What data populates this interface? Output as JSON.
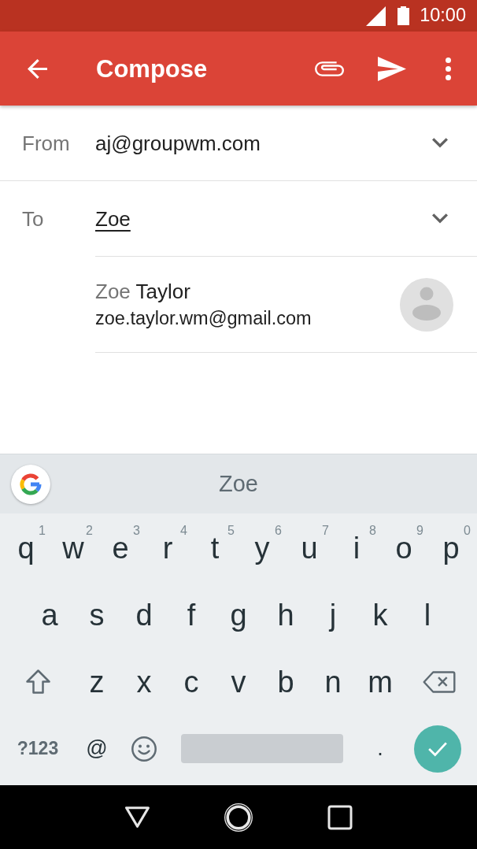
{
  "status_bar": {
    "time": "10:00"
  },
  "app_bar": {
    "title": "Compose"
  },
  "from": {
    "label": "From",
    "value": "aj@groupwm.com"
  },
  "to": {
    "label": "To",
    "value": "Zoe"
  },
  "contact_suggestions": [
    {
      "name_parts": [
        {
          "text": "Zoe",
          "matched": true
        },
        {
          "text": "Taylor",
          "matched": false
        }
      ],
      "email": "zoe.taylor.wm@gmail.com"
    }
  ],
  "keyboard": {
    "suggestions": [
      "Zoe"
    ],
    "key_rows": [
      {
        "keys": [
          {
            "kind": "char",
            "label": "q",
            "hint": "1"
          },
          {
            "kind": "char",
            "label": "w",
            "hint": "2"
          },
          {
            "kind": "char",
            "label": "e",
            "hint": "3"
          },
          {
            "kind": "char",
            "label": "r",
            "hint": "4"
          },
          {
            "kind": "char",
            "label": "t",
            "hint": "5"
          },
          {
            "kind": "char",
            "label": "y",
            "hint": "6"
          },
          {
            "kind": "char",
            "label": "u",
            "hint": "7"
          },
          {
            "kind": "char",
            "label": "i",
            "hint": "8"
          },
          {
            "kind": "char",
            "label": "o",
            "hint": "9"
          },
          {
            "kind": "char",
            "label": "p",
            "hint": "0"
          }
        ]
      },
      {
        "keys": [
          {
            "kind": "char",
            "label": "a"
          },
          {
            "kind": "char",
            "label": "s"
          },
          {
            "kind": "char",
            "label": "d"
          },
          {
            "kind": "char",
            "label": "f"
          },
          {
            "kind": "char",
            "label": "g"
          },
          {
            "kind": "char",
            "label": "h"
          },
          {
            "kind": "char",
            "label": "j"
          },
          {
            "kind": "char",
            "label": "k"
          },
          {
            "kind": "char",
            "label": "l"
          }
        ]
      },
      {
        "keys": [
          {
            "kind": "shift"
          },
          {
            "kind": "char",
            "label": "z"
          },
          {
            "kind": "char",
            "label": "x"
          },
          {
            "kind": "char",
            "label": "c"
          },
          {
            "kind": "char",
            "label": "v"
          },
          {
            "kind": "char",
            "label": "b"
          },
          {
            "kind": "char",
            "label": "n"
          },
          {
            "kind": "char",
            "label": "m"
          },
          {
            "kind": "backspace"
          }
        ]
      },
      {
        "keys": [
          {
            "kind": "symbols",
            "label": "?123"
          },
          {
            "kind": "punct",
            "label": "@"
          },
          {
            "kind": "emoji"
          },
          {
            "kind": "space"
          },
          {
            "kind": "punct",
            "label": "."
          },
          {
            "kind": "enter"
          }
        ]
      }
    ]
  }
}
